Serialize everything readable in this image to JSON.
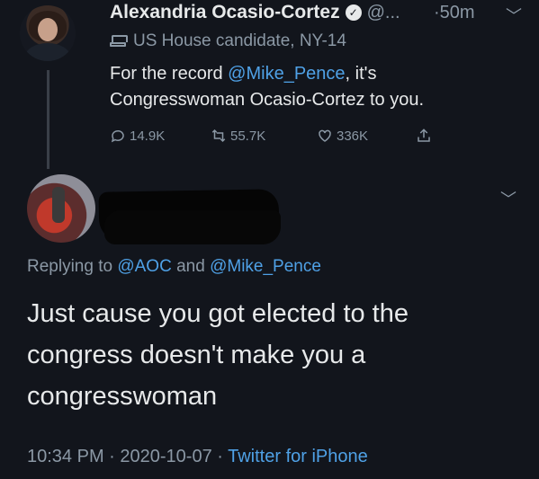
{
  "original_tweet": {
    "display_name": "Alexandria Ocasio-Cortez",
    "handle": "@...",
    "time": "·50m",
    "role": "US House candidate, NY-14",
    "text_prefix": "For the record ",
    "mention": "@Mike_Pence",
    "text_suffix": ", it's Congresswoman Ocasio-Cortez to you.",
    "replies": "14.9K",
    "retweets": "55.7K",
    "likes": "336K"
  },
  "reply_tweet": {
    "replying_label": "Replying to ",
    "mention_1": "@AOC",
    "and_label": " and ",
    "mention_2": "@Mike_Pence",
    "text": "Just cause you got elected to the congress doesn't make you a congresswoman",
    "time": "10:34 PM",
    "date": "2020-10-07",
    "separator": " · ",
    "source": "Twitter for iPhone"
  },
  "colors": {
    "background": "#12151c",
    "text": "#e7e9ea",
    "secondary": "#8b98a5",
    "link": "#4fa1e6"
  }
}
